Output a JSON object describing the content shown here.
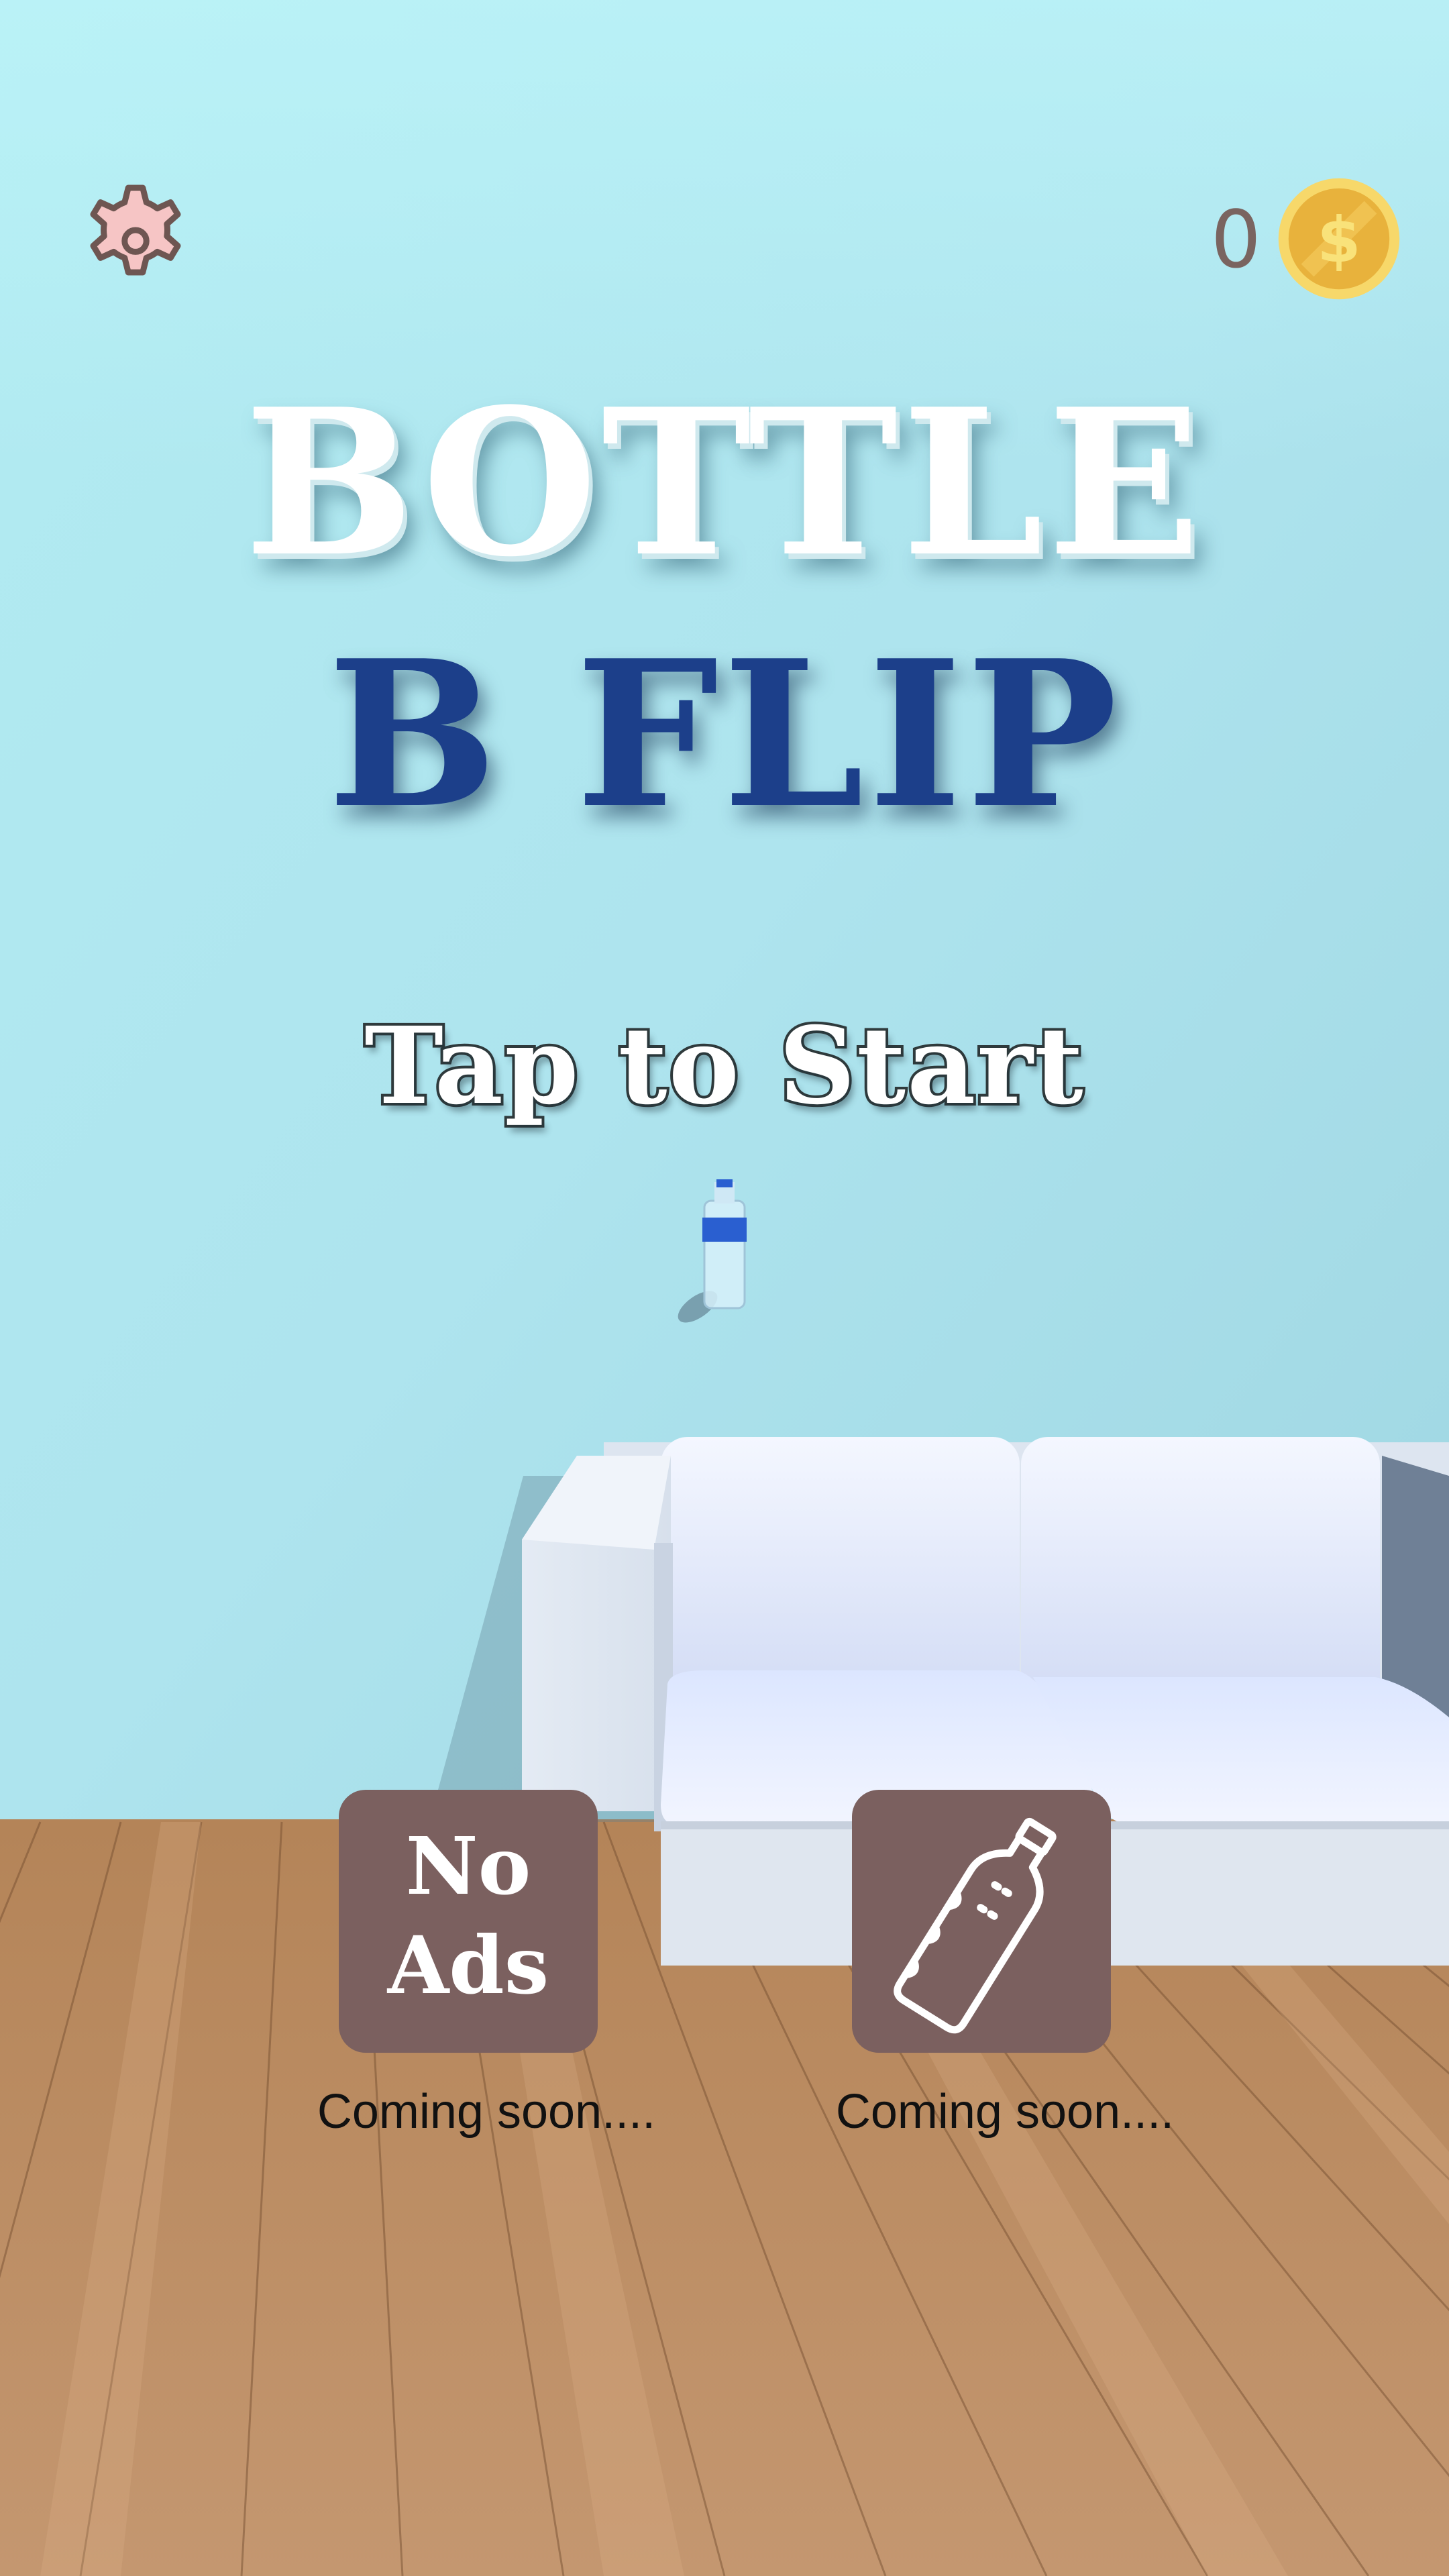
{
  "game": {
    "title_line1": "BOTTLE",
    "title_line2": "B FLIP",
    "tap_prompt": "Tap to Start"
  },
  "hud": {
    "coin_count": "0",
    "settings_icon": "gear-icon",
    "coin_icon": "dollar-coin-icon"
  },
  "shop": {
    "no_ads_label": "No Ads",
    "no_ads_status": "Coming soon....",
    "bottle_icon": "bottle-icon",
    "bottle_status": "Coming soon...."
  },
  "colors": {
    "wall": "#a8e2ec",
    "floor": "#c0916a",
    "title_blue": "#1c3f8a",
    "button_brown": "#7b605f",
    "gear_pink": "#f5c4c4",
    "coin_gold": "#f2c242"
  }
}
